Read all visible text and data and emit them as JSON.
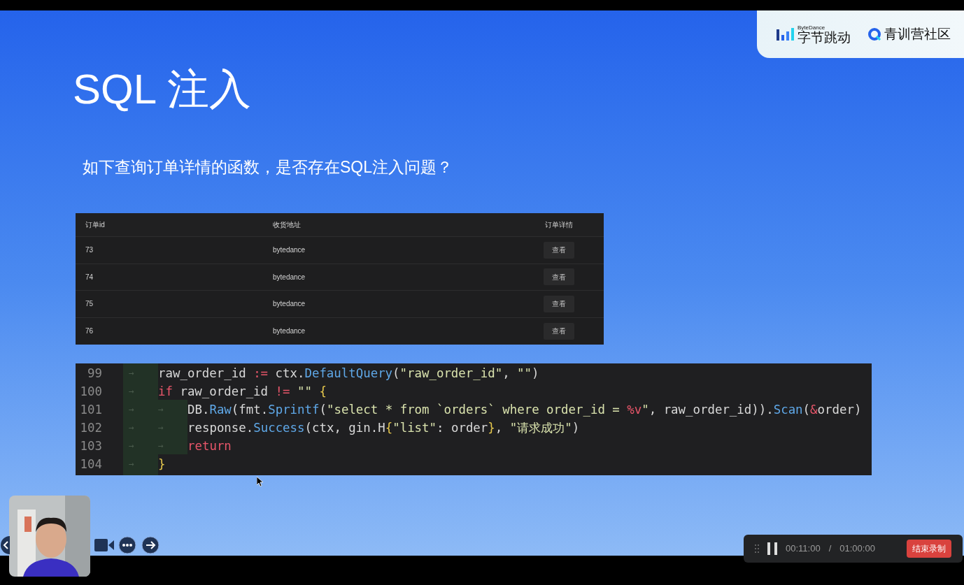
{
  "logos": {
    "bytedance_small": "ByteDance",
    "bytedance": "字节跳动",
    "camp": "青训营社区"
  },
  "slide": {
    "title": "SQL 注入",
    "question": "如下查询订单详情的函数，是否存在SQL注入问题？"
  },
  "table": {
    "columns": [
      "订单id",
      "收货地址",
      "订单详情"
    ],
    "rows": [
      {
        "id": "73",
        "address": "bytedance",
        "action": "查看"
      },
      {
        "id": "74",
        "address": "bytedance",
        "action": "查看"
      },
      {
        "id": "75",
        "address": "bytedance",
        "action": "查看"
      },
      {
        "id": "76",
        "address": "bytedance",
        "action": "查看"
      }
    ]
  },
  "code": [
    {
      "number": "99",
      "tabs": [
        "→"
      ],
      "tokens": [
        {
          "kind": "plain",
          "text": "raw_order_id "
        },
        {
          "kind": "kw",
          "text": ":="
        },
        {
          "kind": "plain",
          "text": " ctx."
        },
        {
          "kind": "fn",
          "text": "DefaultQuery"
        },
        {
          "kind": "plain",
          "text": "("
        },
        {
          "kind": "str",
          "text": "\"raw_order_id\""
        },
        {
          "kind": "plain",
          "text": ", "
        },
        {
          "kind": "str",
          "text": "\"\""
        },
        {
          "kind": "plain",
          "text": ")"
        }
      ]
    },
    {
      "number": "100",
      "tabs": [
        "→"
      ],
      "tokens": [
        {
          "kind": "kw",
          "text": "if"
        },
        {
          "kind": "plain",
          "text": " raw_order_id "
        },
        {
          "kind": "kw",
          "text": "!="
        },
        {
          "kind": "str",
          "text": " \"\""
        },
        {
          "kind": "brace",
          "text": " {"
        }
      ]
    },
    {
      "number": "101",
      "tabs": [
        "→",
        "→"
      ],
      "tokens": [
        {
          "kind": "plain",
          "text": "DB."
        },
        {
          "kind": "fn",
          "text": "Raw"
        },
        {
          "kind": "plain",
          "text": "(fmt."
        },
        {
          "kind": "fn",
          "text": "Sprintf"
        },
        {
          "kind": "plain",
          "text": "("
        },
        {
          "kind": "str",
          "text": "\"select * from `orders` where order_id = "
        },
        {
          "kind": "fmt",
          "text": "%v"
        },
        {
          "kind": "str",
          "text": "\""
        },
        {
          "kind": "plain",
          "text": ", raw_order_id))."
        },
        {
          "kind": "fn",
          "text": "Scan"
        },
        {
          "kind": "plain",
          "text": "("
        },
        {
          "kind": "kw",
          "text": "&"
        },
        {
          "kind": "plain",
          "text": "order)"
        }
      ]
    },
    {
      "number": "102",
      "tabs": [
        "→",
        "→"
      ],
      "tokens": [
        {
          "kind": "plain",
          "text": "response."
        },
        {
          "kind": "fn",
          "text": "Success"
        },
        {
          "kind": "plain",
          "text": "(ctx, gin.H"
        },
        {
          "kind": "brace",
          "text": "{"
        },
        {
          "kind": "str",
          "text": "\"list\""
        },
        {
          "kind": "plain",
          "text": ": order"
        },
        {
          "kind": "brace",
          "text": "}"
        },
        {
          "kind": "plain",
          "text": ", "
        },
        {
          "kind": "str",
          "text": "\"请求成功\""
        },
        {
          "kind": "plain",
          "text": ")"
        }
      ]
    },
    {
      "number": "103",
      "tabs": [
        "→",
        "→"
      ],
      "tokens": [
        {
          "kind": "kw",
          "text": "return"
        }
      ]
    },
    {
      "number": "104",
      "tabs": [
        "→"
      ],
      "tokens": [
        {
          "kind": "brace",
          "text": "}"
        }
      ]
    }
  ],
  "recording": {
    "elapsed": "00:11:00",
    "separator": "/",
    "limit": "01:00:00",
    "stop_button": "结束录制"
  }
}
